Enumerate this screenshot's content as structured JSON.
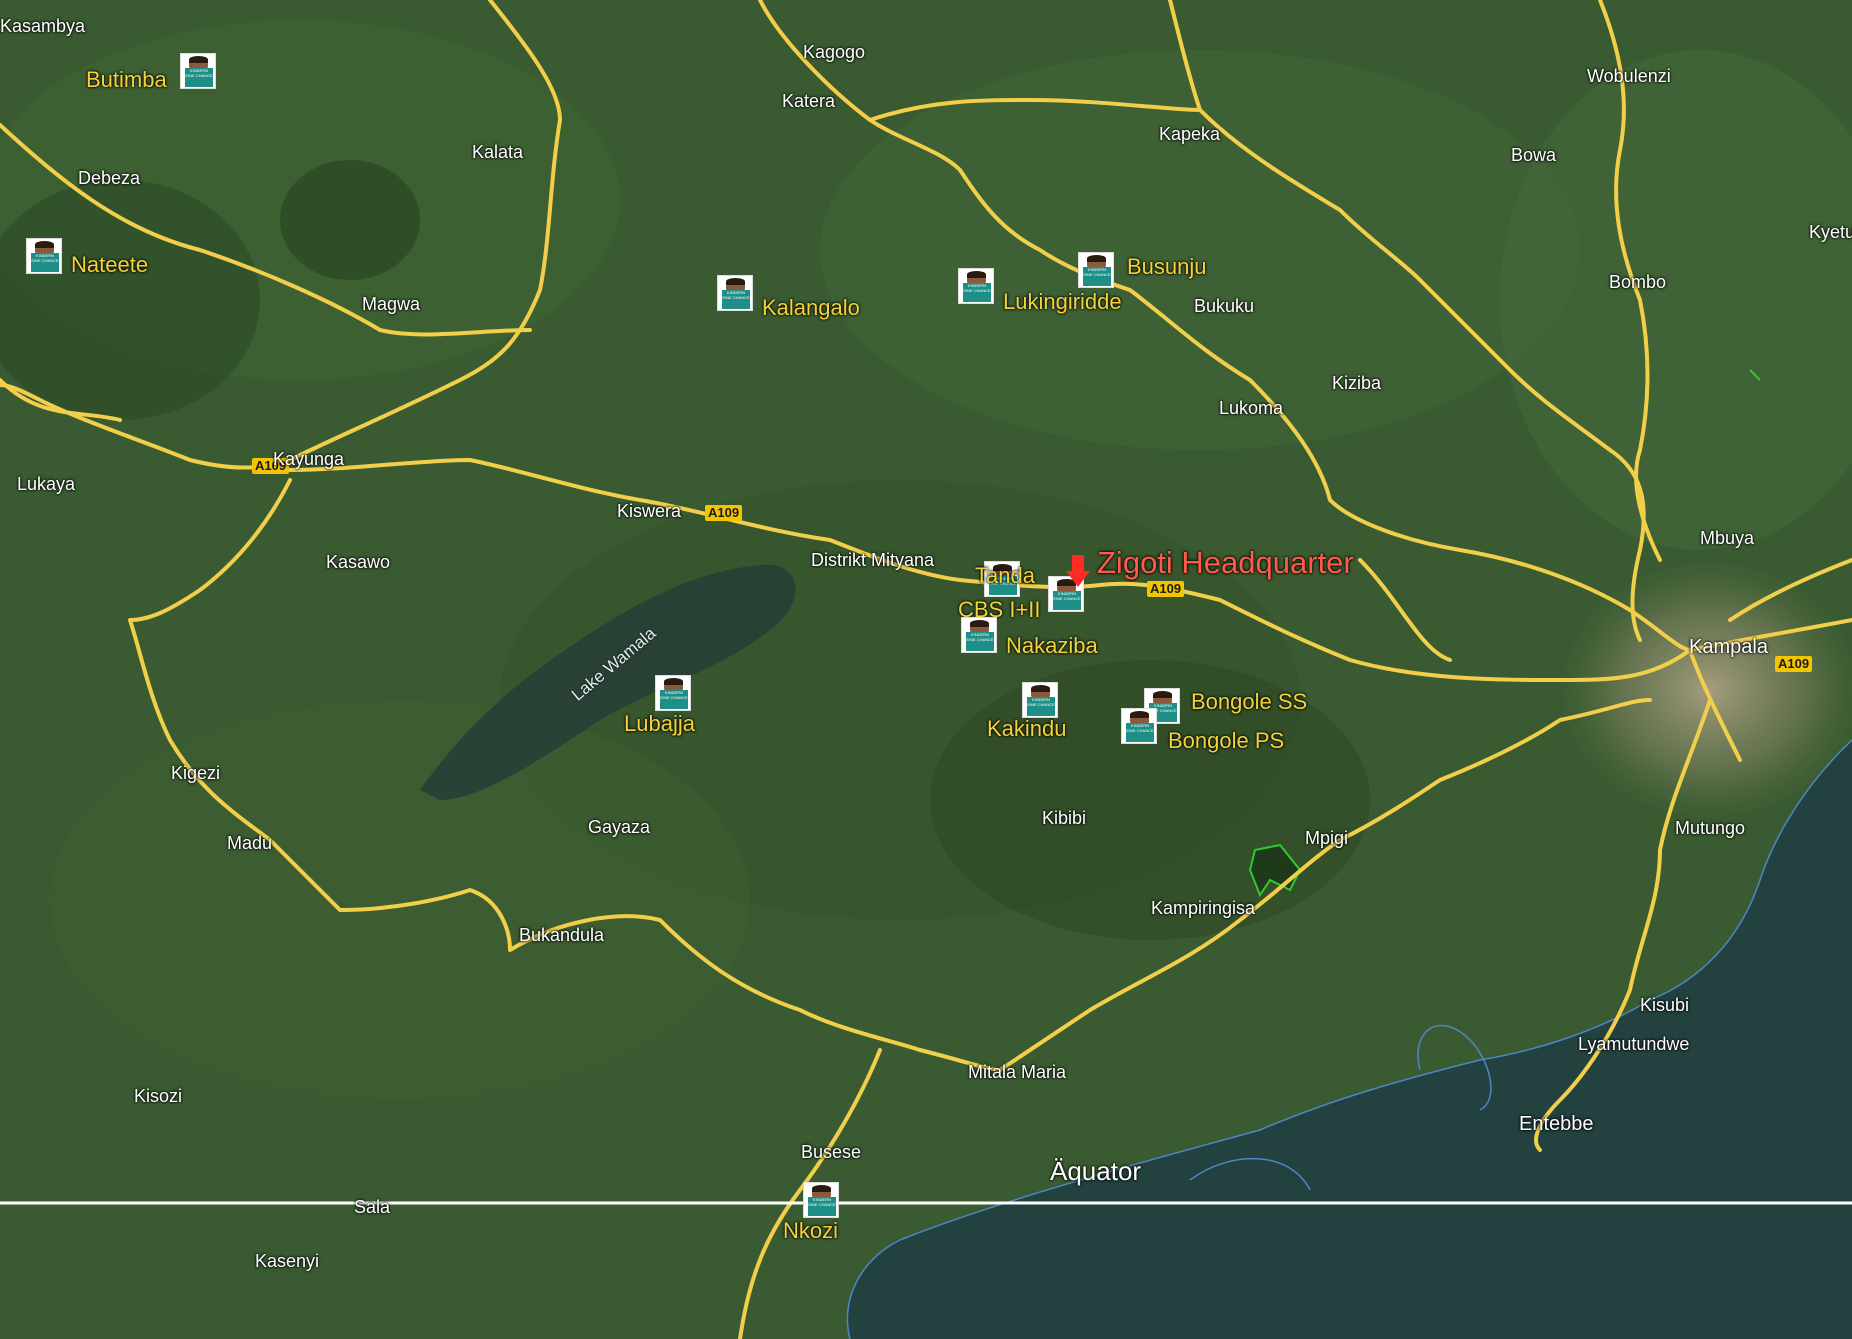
{
  "map": {
    "equator": {
      "label": "Äquator"
    },
    "headquarter": {
      "label": "Zigoti Headquarter",
      "color": "#ff3b2f"
    },
    "lake": {
      "label": "Lake Wamala"
    },
    "road_shields": [
      "A109",
      "A109",
      "A109",
      "A109"
    ],
    "towns": [
      "Kasambya",
      "Kagogo",
      "Katera",
      "Wobulenzi",
      "Kapeka",
      "Bowa",
      "Kalata",
      "Debeza",
      "Kyetu",
      "Bombo",
      "Magwa",
      "Bukuku",
      "Kiziba",
      "Lukoma",
      "Kayunga",
      "Lukaya",
      "Kiswera",
      "Distrikt Mityana",
      "Mbuya",
      "Kasawo",
      "Kampala",
      "Kigezi",
      "Madu",
      "Gayaza",
      "Kibibi",
      "Mpigi",
      "Mutungo",
      "Kampiringisa",
      "Bukandula",
      "Kisubi",
      "Lyamutundwe",
      "Mitala Maria",
      "Entebbe",
      "Kisozi",
      "Busese",
      "Sala",
      "Kasenyi"
    ],
    "schools": [
      "Butimba",
      "Nateete",
      "Kalangalo",
      "Lukingiridde",
      "Busunju",
      "Tanda",
      "CBS I+II",
      "Nakaziba",
      "Lubajja",
      "Kakindu",
      "Bongole SS",
      "Bongole PS",
      "Nkozi"
    ],
    "marker_icon": "school-child-sign-icon",
    "marker_sign_text": "KINDERN EINE CHANCE",
    "colors": {
      "road": "#f2cf4a",
      "school_label": "#f3d23a",
      "hq_label": "#ff5a4a",
      "water": "#23423f",
      "terrain": "#385a30"
    }
  }
}
